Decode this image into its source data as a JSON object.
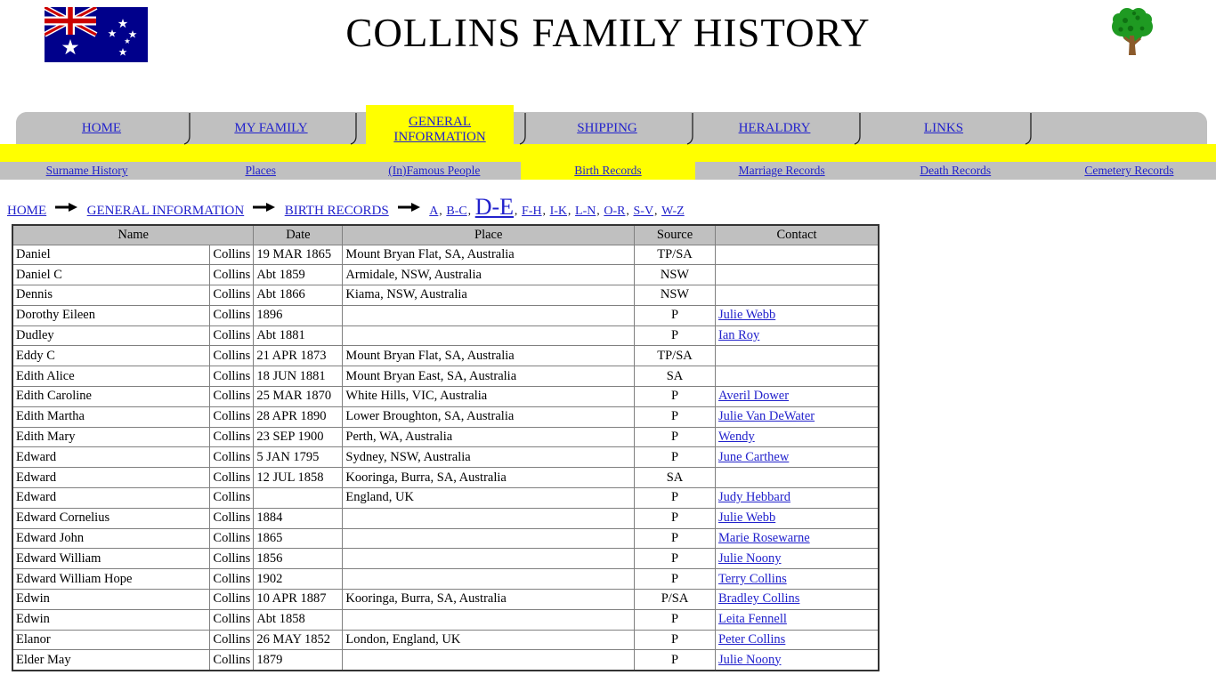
{
  "header": {
    "title": "COLLINS FAMILY HISTORY",
    "flag_alt": "australian-flag",
    "tree_alt": "family-tree"
  },
  "tabs": [
    {
      "label": "HOME",
      "active": false
    },
    {
      "label": "MY FAMILY",
      "active": false
    },
    {
      "label": "GENERAL INFORMATION",
      "active": true
    },
    {
      "label": "SHIPPING",
      "active": false
    },
    {
      "label": "HERALDRY",
      "active": false
    },
    {
      "label": "LINKS",
      "active": false
    },
    {
      "label": "",
      "active": false
    }
  ],
  "subnav": [
    {
      "label": "Surname History",
      "active": false
    },
    {
      "label": "Places",
      "active": false
    },
    {
      "label": "(In)Famous People",
      "active": false
    },
    {
      "label": "Birth Records",
      "active": true
    },
    {
      "label": "Marriage Records",
      "active": false
    },
    {
      "label": "Death Records",
      "active": false
    },
    {
      "label": "Cemetery Records",
      "active": false
    }
  ],
  "breadcrumb": {
    "trail": [
      "HOME",
      "GENERAL INFORMATION",
      "BIRTH RECORDS"
    ],
    "alpha_ranges": [
      {
        "label": "A",
        "current": false
      },
      {
        "label": "B-C",
        "current": false
      },
      {
        "label": "D-E",
        "current": true
      },
      {
        "label": "F-H",
        "current": false
      },
      {
        "label": "I-K",
        "current": false
      },
      {
        "label": "L-N",
        "current": false
      },
      {
        "label": "O-R",
        "current": false
      },
      {
        "label": "S-V",
        "current": false
      },
      {
        "label": "W-Z",
        "current": false
      }
    ],
    "separator": ","
  },
  "table": {
    "columns": [
      "Name",
      "Date",
      "Place",
      "Source",
      "Contact"
    ],
    "rows": [
      {
        "given": "Daniel",
        "surname": "Collins",
        "date": "19 MAR 1865",
        "place": "Mount Bryan Flat, SA, Australia",
        "source": "TP/SA",
        "contact": ""
      },
      {
        "given": "Daniel C",
        "surname": "Collins",
        "date": "Abt 1859",
        "place": "Armidale, NSW, Australia",
        "source": "NSW",
        "contact": ""
      },
      {
        "given": "Dennis",
        "surname": "Collins",
        "date": "Abt 1866",
        "place": "Kiama, NSW, Australia",
        "source": "NSW",
        "contact": ""
      },
      {
        "given": "Dorothy Eileen",
        "surname": "Collins",
        "date": "1896",
        "place": "",
        "source": "P",
        "contact": "Julie Webb"
      },
      {
        "given": "Dudley",
        "surname": "Collins",
        "date": "Abt 1881",
        "place": "",
        "source": "P",
        "contact": "Ian Roy"
      },
      {
        "given": "Eddy C",
        "surname": "Collins",
        "date": "21 APR 1873",
        "place": "Mount Bryan Flat, SA, Australia",
        "source": "TP/SA",
        "contact": ""
      },
      {
        "given": "Edith Alice",
        "surname": "Collins",
        "date": "18 JUN 1881",
        "place": "Mount Bryan East, SA, Australia",
        "source": "SA",
        "contact": ""
      },
      {
        "given": "Edith Caroline",
        "surname": "Collins",
        "date": "25 MAR 1870",
        "place": "White Hills, VIC, Australia",
        "source": "P",
        "contact": "Averil Dower"
      },
      {
        "given": "Edith Martha",
        "surname": "Collins",
        "date": "28 APR 1890",
        "place": "Lower Broughton, SA, Australia",
        "source": "P",
        "contact": "Julie Van DeWater"
      },
      {
        "given": "Edith Mary",
        "surname": "Collins",
        "date": "23 SEP 1900",
        "place": "Perth, WA, Australia",
        "source": "P",
        "contact": "Wendy"
      },
      {
        "given": "Edward",
        "surname": "Collins",
        "date": "5 JAN 1795",
        "place": "Sydney, NSW, Australia",
        "source": "P",
        "contact": "June Carthew"
      },
      {
        "given": "Edward",
        "surname": "Collins",
        "date": "12 JUL 1858",
        "place": "Kooringa, Burra, SA, Australia",
        "source": "SA",
        "contact": ""
      },
      {
        "given": "Edward",
        "surname": "Collins",
        "date": "",
        "place": "England, UK",
        "source": "P",
        "contact": "Judy Hebbard"
      },
      {
        "given": "Edward Cornelius",
        "surname": "Collins",
        "date": "1884",
        "place": "",
        "source": "P",
        "contact": "Julie Webb"
      },
      {
        "given": "Edward John",
        "surname": "Collins",
        "date": "1865",
        "place": "",
        "source": "P",
        "contact": "Marie Rosewarne"
      },
      {
        "given": "Edward William",
        "surname": "Collins",
        "date": "1856",
        "place": "",
        "source": "P",
        "contact": "Julie Noony"
      },
      {
        "given": "Edward William Hope",
        "surname": "Collins",
        "date": "1902",
        "place": "",
        "source": "P",
        "contact": "Terry Collins"
      },
      {
        "given": "Edwin",
        "surname": "Collins",
        "date": "10 APR 1887",
        "place": "Kooringa, Burra, SA, Australia",
        "source": "P/SA",
        "contact": "Bradley Collins"
      },
      {
        "given": "Edwin",
        "surname": "Collins",
        "date": "Abt 1858",
        "place": "",
        "source": "P",
        "contact": "Leita Fennell"
      },
      {
        "given": "Elanor",
        "surname": "Collins",
        "date": "26 MAY 1852",
        "place": "London, England, UK",
        "source": "P",
        "contact": "Peter Collins"
      },
      {
        "given": "Elder May",
        "surname": "Collins",
        "date": "1879",
        "place": "",
        "source": "P",
        "contact": "Julie Noony"
      }
    ]
  },
  "colors": {
    "link": "#2222cc",
    "tab_gray": "#c0c0c0",
    "highlight_yellow": "#ffff00",
    "flag_blue": "#00008b",
    "flag_red": "#cc0000",
    "tree_green": "#1a9a1a",
    "tree_trunk": "#8b5a2b"
  }
}
